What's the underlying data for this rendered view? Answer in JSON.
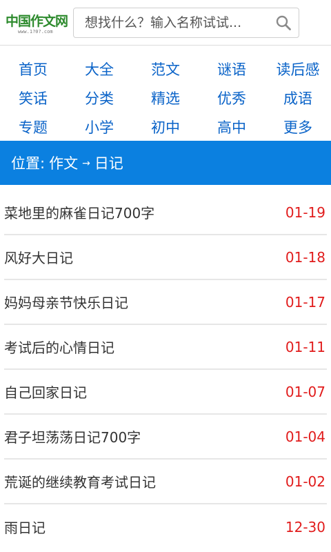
{
  "header": {
    "logo_text": "中国作文网",
    "logo_sub": "www.1?0?.com",
    "search_placeholder": "想找什么？输入名称试试..."
  },
  "nav": {
    "items": [
      "首页",
      "大全",
      "范文",
      "谜语",
      "读后感",
      "笑话",
      "分类",
      "精选",
      "优秀",
      "成语",
      "专题",
      "小学",
      "初中",
      "高中",
      "更多"
    ]
  },
  "location": {
    "prefix": "位置:",
    "crumb1": "作文",
    "arrow": "→",
    "crumb2": "日记"
  },
  "list": [
    {
      "title": "菜地里的麻雀日记700字",
      "date": "01-19"
    },
    {
      "title": "风好大日记",
      "date": "01-18"
    },
    {
      "title": "妈妈母亲节快乐日记",
      "date": "01-17"
    },
    {
      "title": "考试后的心情日记",
      "date": "01-11"
    },
    {
      "title": "自己回家日记",
      "date": "01-07"
    },
    {
      "title": "君子坦荡荡日记700字",
      "date": "01-04"
    },
    {
      "title": "荒诞的继续教育考试日记",
      "date": "01-02"
    },
    {
      "title": "雨日记",
      "date": "12-30"
    }
  ],
  "colors": {
    "accent": "#0b80e0",
    "nav_link": "#0a63c8",
    "date": "#e11c1c",
    "logo": "#2c8a2c"
  },
  "icons": [
    "search-icon"
  ]
}
